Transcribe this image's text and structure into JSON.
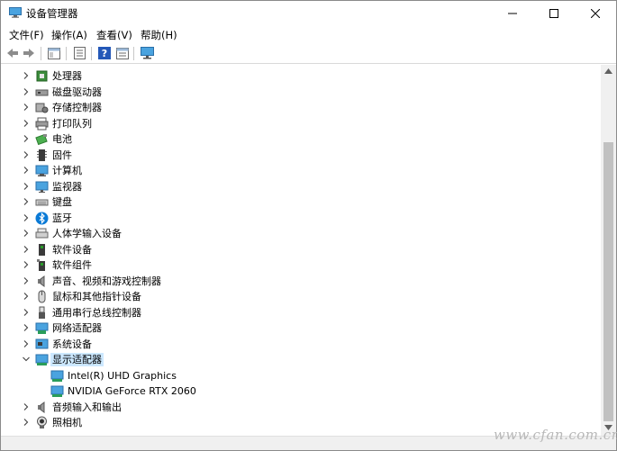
{
  "window": {
    "title": "设备管理器",
    "controls": {
      "minimize": "minimize",
      "maximize": "maximize",
      "close": "close"
    }
  },
  "menubar": {
    "items": [
      {
        "label": "文件(F)"
      },
      {
        "label": "操作(A)"
      },
      {
        "label": "查看(V)"
      },
      {
        "label": "帮助(H)"
      }
    ]
  },
  "toolbar": {
    "buttons": [
      "back-arrow-icon",
      "forward-arrow-icon",
      "console-tree-icon",
      "properties-icon",
      "help-icon",
      "view-icon",
      "monitor-scan-icon"
    ]
  },
  "tree": {
    "items": [
      {
        "label": "处理器",
        "icon": "processor-icon",
        "level": 0,
        "expanded": false
      },
      {
        "label": "磁盘驱动器",
        "icon": "disk-drive-icon",
        "level": 0,
        "expanded": false
      },
      {
        "label": "存储控制器",
        "icon": "storage-controller-icon",
        "level": 0,
        "expanded": false
      },
      {
        "label": "打印队列",
        "icon": "printer-icon",
        "level": 0,
        "expanded": false
      },
      {
        "label": "电池",
        "icon": "battery-icon",
        "level": 0,
        "expanded": false
      },
      {
        "label": "固件",
        "icon": "firmware-icon",
        "level": 0,
        "expanded": false
      },
      {
        "label": "计算机",
        "icon": "computer-icon",
        "level": 0,
        "expanded": false
      },
      {
        "label": "监视器",
        "icon": "monitor-icon",
        "level": 0,
        "expanded": false
      },
      {
        "label": "键盘",
        "icon": "keyboard-icon",
        "level": 0,
        "expanded": false
      },
      {
        "label": "蓝牙",
        "icon": "bluetooth-icon",
        "level": 0,
        "expanded": false
      },
      {
        "label": "人体学输入设备",
        "icon": "hid-icon",
        "level": 0,
        "expanded": false
      },
      {
        "label": "软件设备",
        "icon": "software-device-icon",
        "level": 0,
        "expanded": false
      },
      {
        "label": "软件组件",
        "icon": "software-component-icon",
        "level": 0,
        "expanded": false
      },
      {
        "label": "声音、视频和游戏控制器",
        "icon": "speaker-icon",
        "level": 0,
        "expanded": false
      },
      {
        "label": "鼠标和其他指针设备",
        "icon": "mouse-icon",
        "level": 0,
        "expanded": false
      },
      {
        "label": "通用串行总线控制器",
        "icon": "usb-icon",
        "level": 0,
        "expanded": false
      },
      {
        "label": "网络适配器",
        "icon": "network-adapter-icon",
        "level": 0,
        "expanded": false
      },
      {
        "label": "系统设备",
        "icon": "system-device-icon",
        "level": 0,
        "expanded": false
      },
      {
        "label": "显示适配器",
        "icon": "display-adapter-icon",
        "level": 0,
        "expanded": true,
        "selected": true
      },
      {
        "label": "Intel(R) UHD Graphics",
        "icon": "display-adapter-icon",
        "level": 1
      },
      {
        "label": "NVIDIA GeForce RTX 2060",
        "icon": "display-adapter-icon",
        "level": 1
      },
      {
        "label": "音频输入和输出",
        "icon": "speaker-icon",
        "level": 0,
        "expanded": false
      },
      {
        "label": "照相机",
        "icon": "camera-icon",
        "level": 0,
        "expanded": false
      }
    ]
  },
  "watermark": "www.cfan.com.cn",
  "colors": {
    "selection": "#cce8ff",
    "scroll_track": "#f0f0f0",
    "scroll_thumb": "#c1c1c1"
  }
}
